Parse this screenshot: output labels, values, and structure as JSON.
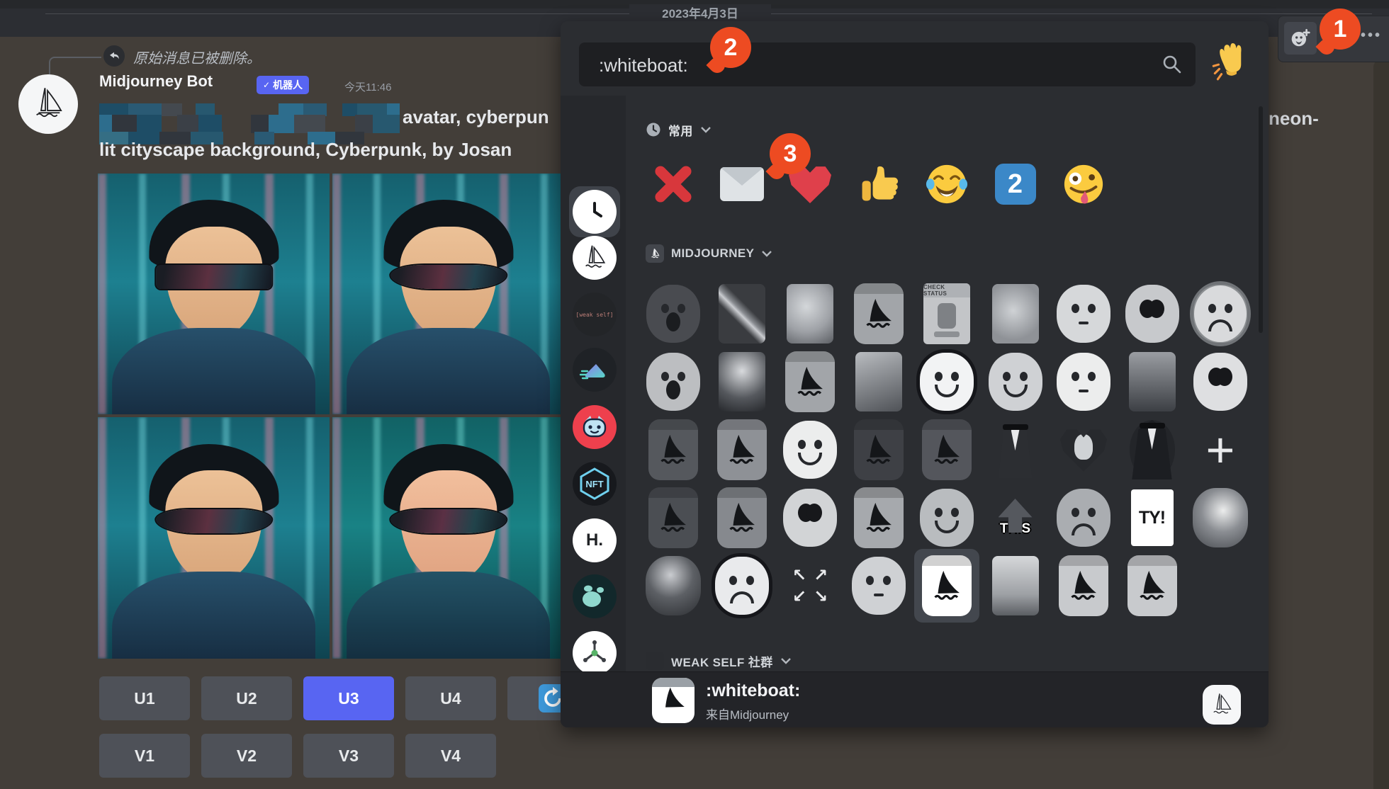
{
  "colors": {
    "accent": "#5865f2",
    "annotation_badge": "#ed4b22",
    "keycap_blue": "#3b88c8",
    "heart_red": "#df404b",
    "cross_red": "#d8373c"
  },
  "date_divider": {
    "label": "2023年4月3日"
  },
  "reply_bar": {
    "text": "原始消息已被删除。"
  },
  "message": {
    "author": "Midjourney Bot",
    "badge_check": "✓",
    "badge_label": "机器人",
    "timestamp": "今天11:46",
    "prompt_line1_visible": "avatar, cyberpun",
    "prompt_line1_right_fragment": "neon-",
    "prompt_line2": "lit cityscape background, Cyberpunk, by Josan",
    "censor_palette": [
      "#2d6d8d",
      "#1e4d66",
      "#356e84",
      "#3b4047",
      "#27586f",
      "#44494f",
      "#2a5a74",
      "#31363d"
    ]
  },
  "action_buttons": {
    "row1": [
      "U1",
      "U2",
      "U3",
      "U4"
    ],
    "row2": [
      "V1",
      "V2",
      "V3",
      "V4"
    ],
    "selected": "U3"
  },
  "annotations": [
    {
      "label": "1"
    },
    {
      "label": "2"
    },
    {
      "label": "3"
    }
  ],
  "hover_toolbar": {
    "more_label": "•••"
  },
  "picker": {
    "search": {
      "value": ":whiteboat:"
    },
    "frequent": {
      "label": "常用",
      "emojis": [
        {
          "name": "cross"
        },
        {
          "name": "envelope"
        },
        {
          "name": "heart"
        },
        {
          "name": "thumbs-up"
        },
        {
          "name": "joy"
        },
        {
          "name": "keycap-2",
          "digit": "2"
        },
        {
          "name": "zany"
        }
      ]
    },
    "sidebar": [
      {
        "name": "recent",
        "kind": "clock",
        "selected": true
      },
      {
        "name": "midjourney-server",
        "kind": "boat-circle"
      },
      {
        "name": "weak-self-server",
        "kind": "weakself",
        "label": "[weak self]"
      },
      {
        "name": "shoe-server",
        "kind": "shoe"
      },
      {
        "name": "cat-server",
        "kind": "cat"
      },
      {
        "name": "nft-server",
        "kind": "nft",
        "label": "NFT"
      },
      {
        "name": "h-dot-server",
        "kind": "hdot",
        "label": "H."
      },
      {
        "name": "paw-server",
        "kind": "paw"
      },
      {
        "name": "molecule-server",
        "kind": "molecule"
      },
      {
        "name": "crystal-server",
        "kind": "crystal"
      },
      {
        "name": "standard-emoji",
        "kind": "smiley"
      }
    ],
    "midjourney_section": {
      "label": "MIDJOURNEY"
    },
    "grid": [
      {
        "name": "dark-blob",
        "kind": "blob",
        "bg": "#494b50",
        "face": "scream"
      },
      {
        "name": "sword",
        "kind": "photo",
        "art": "sword"
      },
      {
        "name": "dog",
        "kind": "photo",
        "art": "dog"
      },
      {
        "name": "whiteboat-gray",
        "kind": "boat",
        "tile": "#a2a5a9"
      },
      {
        "name": "check-status-bot",
        "kind": "robot",
        "label": "CHECK STATUS"
      },
      {
        "name": "dog-2",
        "kind": "photo",
        "art": "dog2"
      },
      {
        "name": "octopus-face",
        "kind": "blob",
        "bg": "#d6d8da",
        "face": "stare"
      },
      {
        "name": "big-eyes-blob",
        "kind": "blob",
        "bg": "#c7c9cc",
        "face": "bigeyes"
      },
      {
        "name": "banana-ghost",
        "kind": "blob",
        "bg": "#d9dadc",
        "face": "frown",
        "ring": true
      },
      {
        "name": "screaming-blob",
        "kind": "blob",
        "bg": "#bcbec1",
        "face": "scream"
      },
      {
        "name": "portrait",
        "kind": "photo",
        "art": "portrait"
      },
      {
        "name": "whiteboat-gray-2",
        "kind": "boat",
        "tile": "#a2a5a9"
      },
      {
        "name": "bear",
        "kind": "photo",
        "art": "bear"
      },
      {
        "name": "sketch-smiley",
        "kind": "blob",
        "bg": "#f2f3f4",
        "face": "smile",
        "outline": true
      },
      {
        "name": "laughing-mask",
        "kind": "blob",
        "bg": "#cfd1d4",
        "face": "smile"
      },
      {
        "name": "cat-paw",
        "kind": "blob",
        "bg": "#eceded",
        "face": "stare"
      },
      {
        "name": "muscle-man",
        "kind": "photo",
        "art": "muscle"
      },
      {
        "name": "cookie-blob",
        "kind": "blob",
        "bg": "#dedfe1",
        "face": "bigeyes"
      },
      {
        "name": "boat-dark",
        "kind": "boat",
        "tile": "#55585d"
      },
      {
        "name": "boat-mid",
        "kind": "boat",
        "tile": "#8e9196"
      },
      {
        "name": "white-blob",
        "kind": "blob",
        "bg": "#eceded",
        "face": "smile"
      },
      {
        "name": "boat-darker",
        "kind": "boat",
        "tile": "#3e4045"
      },
      {
        "name": "boat-dark-2",
        "kind": "boat",
        "tile": "#54565c"
      },
      {
        "name": "plague-doctor",
        "kind": "plague",
        "bg": "#2c2e32"
      },
      {
        "name": "skull-heart",
        "kind": "heart-skull"
      },
      {
        "name": "plague-doctor-2",
        "kind": "plague",
        "bg": "#1c1e22",
        "oval": true
      },
      {
        "name": "plus",
        "kind": "plus",
        "label": "+"
      },
      {
        "name": "boat-dark-3",
        "kind": "boat",
        "tile": "#4b4e53"
      },
      {
        "name": "boat-mid-2",
        "kind": "boat",
        "tile": "#86898e"
      },
      {
        "name": "egg-eyes",
        "kind": "blob",
        "bg": "#d2d4d6",
        "face": "bigeyes"
      },
      {
        "name": "boat-mid-3",
        "kind": "boat",
        "tile": "#a6a9ad"
      },
      {
        "name": "ghost-blob",
        "kind": "blob",
        "bg": "#b9bcbf",
        "face": "smile"
      },
      {
        "name": "this-arrow",
        "kind": "this",
        "label": "THIS"
      },
      {
        "name": "rock-face",
        "kind": "blob",
        "bg": "#aaadb1",
        "face": "frown"
      },
      {
        "name": "ty",
        "kind": "text",
        "label": "TY!",
        "tile": "#ffffff",
        "color": "#17181a"
      },
      {
        "name": "galaxy",
        "kind": "photo",
        "art": "galaxy"
      },
      {
        "name": "galaxy-dark",
        "kind": "photo",
        "art": "galaxy2"
      },
      {
        "name": "frown-face",
        "kind": "blob",
        "bg": "#e9eaec",
        "face": "frown",
        "outline": true
      },
      {
        "name": "expand-arrows",
        "kind": "expand",
        "arrows": [
          "↖",
          "↗",
          "↙",
          "↘"
        ]
      },
      {
        "name": "moon-face",
        "kind": "blob",
        "bg": "#cfd1d4",
        "face": "stare"
      },
      {
        "name": "whiteboat",
        "kind": "boat",
        "tile": "#ffffff",
        "selected": true
      },
      {
        "name": "robot-head",
        "kind": "photo",
        "art": "robot"
      },
      {
        "name": "boat-light",
        "kind": "boat",
        "tile": "#c8cacd"
      },
      {
        "name": "boat-light-2",
        "kind": "boat",
        "tile": "#c8cacd"
      },
      null
    ],
    "weakself_section": {
      "label": "WEAK SELF 社群"
    },
    "preview": {
      "name": ":whiteboat:",
      "source": "来自Midjourney"
    }
  }
}
